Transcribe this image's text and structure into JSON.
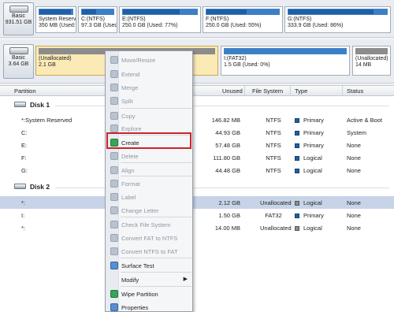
{
  "disk1_map": {
    "info": {
      "label": "Basic",
      "size": "931.51 GB"
    },
    "partitions": [
      {
        "name": "System Reserv",
        "detail": "350 MB (Used:",
        "used_fraction": 0.95
      },
      {
        "name": "C:(NTFS)",
        "detail": "97.3 GB (Used:",
        "used_fraction": 0.45
      },
      {
        "name": "E:(NTFS)",
        "detail": "250.0 GB (Used: 77%)",
        "used_fraction": 0.77
      },
      {
        "name": "F:(NTFS)",
        "detail": "250.0 GB (Used: 55%)",
        "used_fraction": 0.55
      },
      {
        "name": "G:(NTFS)",
        "detail": "333.9 GB (Used: 86%)",
        "used_fraction": 0.86
      }
    ]
  },
  "disk2_map": {
    "info": {
      "label": "Basic",
      "size": "3.64 GB"
    },
    "partitions": [
      {
        "name": "(Unallocated)",
        "detail": "2.1 GB"
      },
      {
        "name": "I:(FAT32)",
        "detail": "1.5 GB (Used: 0%)",
        "used_fraction": 0.0
      },
      {
        "name": "(Unallocated)",
        "detail": "14 MB"
      }
    ]
  },
  "table": {
    "headers": {
      "partition": "Partition",
      "unused": "Unused",
      "fs": "File System",
      "type": "Type",
      "status": "Status"
    },
    "disk1_label": "Disk 1",
    "disk2_label": "Disk 2",
    "disk1_rows": [
      {
        "partition": "*:System Reserved",
        "unused": "146.82 MB",
        "fs": "NTFS",
        "type": "Primary",
        "status": "Active & Boot"
      },
      {
        "partition": "C:",
        "unused": "44.93 GB",
        "fs": "NTFS",
        "type": "Primary",
        "status": "System"
      },
      {
        "partition": "E:",
        "unused": "57.48 GB",
        "fs": "NTFS",
        "type": "Primary",
        "status": "None"
      },
      {
        "partition": "F:",
        "unused": "111.80 GB",
        "fs": "NTFS",
        "type": "Logical",
        "status": "None"
      },
      {
        "partition": "G:",
        "unused": "44.48 GB",
        "fs": "NTFS",
        "type": "Logical",
        "status": "None"
      }
    ],
    "disk2_rows": [
      {
        "partition": "*:",
        "unused": "2.12 GB",
        "fs": "Unallocated",
        "type": "Logical",
        "status": "None"
      },
      {
        "partition": "I:",
        "unused": "1.50 GB",
        "fs": "FAT32",
        "type": "Primary",
        "status": "None"
      },
      {
        "partition": "*:",
        "unused": "14.00 MB",
        "fs": "Unallocated",
        "type": "Logical",
        "status": "None"
      }
    ]
  },
  "context_menu": {
    "items": [
      {
        "label": "Move/Resize",
        "enabled": false
      },
      {
        "label": "Extend",
        "enabled": false
      },
      {
        "label": "Merge",
        "enabled": false
      },
      {
        "label": "Split",
        "enabled": false
      },
      {
        "label": "Copy",
        "enabled": false
      },
      {
        "label": "Explore",
        "enabled": false
      },
      {
        "label": "Create",
        "enabled": true
      },
      {
        "label": "Delete",
        "enabled": false
      },
      {
        "label": "Align",
        "enabled": false
      },
      {
        "label": "Format",
        "enabled": false
      },
      {
        "label": "Label",
        "enabled": false
      },
      {
        "label": "Change Letter",
        "enabled": false
      },
      {
        "label": "Check File System",
        "enabled": false
      },
      {
        "label": "Convert FAT to NTFS",
        "enabled": false
      },
      {
        "label": "Convert NTFS to FAT",
        "enabled": false
      },
      {
        "label": "Surface Test",
        "enabled": true
      },
      {
        "label": "Modify",
        "enabled": true
      },
      {
        "label": "Wipe Partition",
        "enabled": true
      },
      {
        "label": "Properties",
        "enabled": true
      }
    ],
    "highlighted": "Create"
  },
  "colors": {
    "accent": "#3a7fc9",
    "used": "#1e5fa8",
    "selection": "#c7d4e8",
    "highlight_box": "#c9242c",
    "unallocated_sel": "#fbe9b6"
  }
}
